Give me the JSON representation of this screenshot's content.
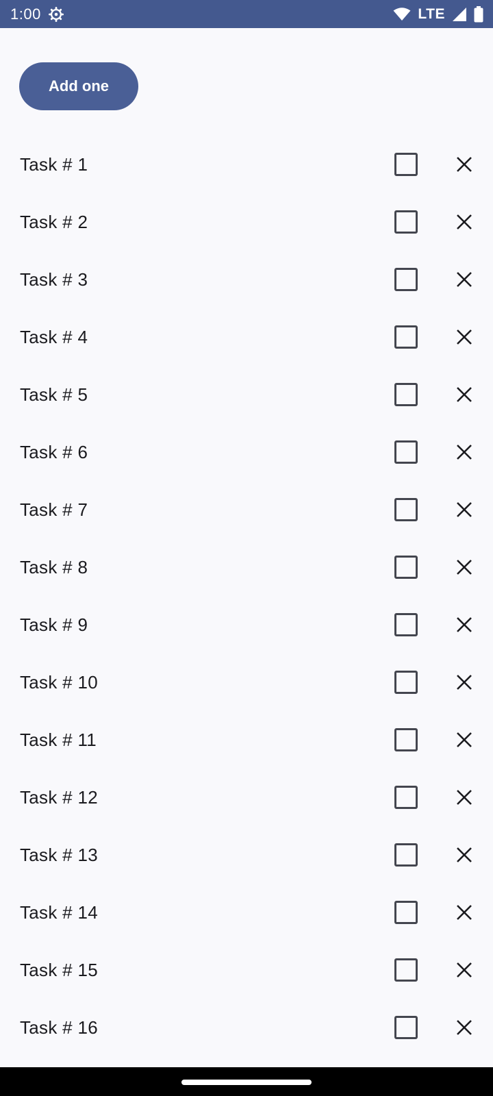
{
  "status_bar": {
    "time": "1:00",
    "network_label": "LTE",
    "icons": [
      "settings-gear-icon",
      "wifi-icon",
      "cellular-signal-icon",
      "battery-icon"
    ],
    "background_color": "#44598f"
  },
  "add_button": {
    "label": "Add one",
    "color": "#4a5f96"
  },
  "tasks": [
    {
      "label": "Task # 1",
      "checked": false
    },
    {
      "label": "Task # 2",
      "checked": false
    },
    {
      "label": "Task # 3",
      "checked": false
    },
    {
      "label": "Task # 4",
      "checked": false
    },
    {
      "label": "Task # 5",
      "checked": false
    },
    {
      "label": "Task # 6",
      "checked": false
    },
    {
      "label": "Task # 7",
      "checked": false
    },
    {
      "label": "Task # 8",
      "checked": false
    },
    {
      "label": "Task # 9",
      "checked": false
    },
    {
      "label": "Task # 10",
      "checked": false
    },
    {
      "label": "Task # 11",
      "checked": false
    },
    {
      "label": "Task # 12",
      "checked": false
    },
    {
      "label": "Task # 13",
      "checked": false
    },
    {
      "label": "Task # 14",
      "checked": false
    },
    {
      "label": "Task # 15",
      "checked": false
    },
    {
      "label": "Task # 16",
      "checked": false
    }
  ],
  "task_row_icons": {
    "checkbox": "checkbox-unchecked-icon",
    "remove": "close-icon"
  }
}
